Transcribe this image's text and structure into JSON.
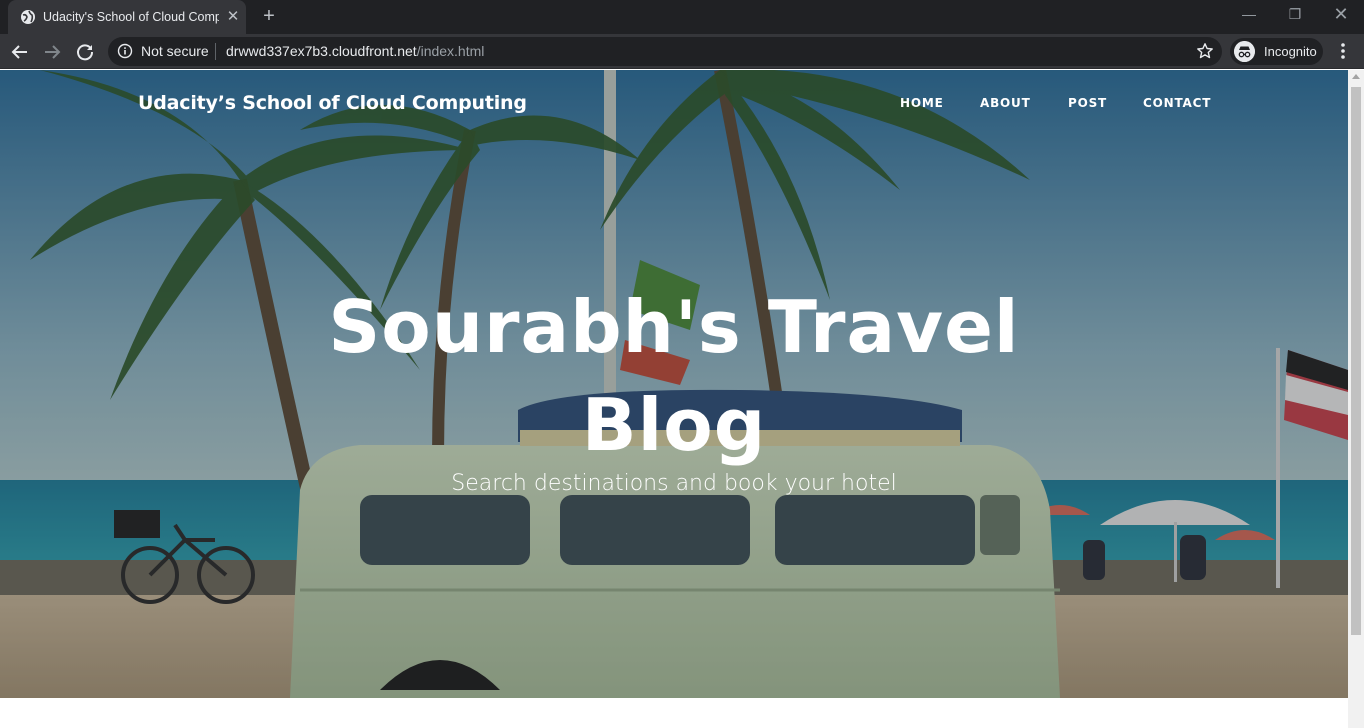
{
  "browser": {
    "tab_title": "Udacity's School of Cloud Computing",
    "new_tab_label": "+",
    "window_controls": {
      "minimize": "—",
      "restore": "❐",
      "close": "✕"
    },
    "security_label": "Not secure",
    "url_host": "drwwd337ex7b3.cloudfront.net",
    "url_path": "/index.html",
    "incognito_label": "Incognito",
    "icons": [
      "globe-icon",
      "close-icon",
      "back-arrow-icon",
      "forward-arrow-icon",
      "reload-icon",
      "info-icon",
      "star-icon",
      "incognito-icon",
      "kebab-menu-icon"
    ]
  },
  "site": {
    "brand": "Udacity’s School of Cloud Computing",
    "nav": {
      "home": "HOME",
      "about": "ABOUT",
      "post": "POST",
      "contact": "CONTACT"
    },
    "hero": {
      "heading": "Sourabh's Travel Blog",
      "subheading": "Search destinations and book your hotel"
    }
  },
  "colors": {
    "chrome_dark": "#202124",
    "chrome_tab": "#35363a",
    "hero_text": "#ffffff"
  }
}
